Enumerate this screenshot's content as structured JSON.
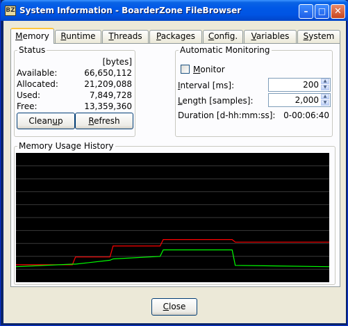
{
  "window": {
    "title": "System Information - BoarderZone FileBrowser",
    "icon_label": "BZ",
    "minimize_icon": "minimize-icon",
    "maximize_icon": "maximize-icon",
    "close_icon": "close-icon"
  },
  "tabs": [
    {
      "label": "Memory",
      "mnemonic": "M",
      "active": true
    },
    {
      "label": "Runtime",
      "mnemonic": "R",
      "active": false
    },
    {
      "label": "Threads",
      "mnemonic": "T",
      "active": false
    },
    {
      "label": "Packages",
      "mnemonic": "P",
      "active": false
    },
    {
      "label": "Config.",
      "mnemonic": "C",
      "active": false
    },
    {
      "label": "Variables",
      "mnemonic": "V",
      "active": false
    },
    {
      "label": "System",
      "mnemonic": "S",
      "active": false
    }
  ],
  "status": {
    "title": "Status",
    "units": "[bytes]",
    "rows": [
      {
        "label": "Available:",
        "value": "66,650,112"
      },
      {
        "label": "Allocated:",
        "value": "21,209,088"
      },
      {
        "label": "Used:",
        "value": "7,849,728"
      },
      {
        "label": "Free:",
        "value": "13,359,360"
      }
    ],
    "cleanup_label": "Cleanup",
    "refresh_label": "Refresh"
  },
  "monitoring": {
    "title": "Automatic Monitoring",
    "monitor_label": "Monitor",
    "monitor_checked": false,
    "interval_label": "Interval [ms]:",
    "interval_value": "200",
    "length_label": "Length [samples]:",
    "length_value": "2,000",
    "duration_label": "Duration [d-hh:mm:ss]:",
    "duration_value": "0-00:06:40"
  },
  "history": {
    "title": "Memory Usage History"
  },
  "chart_data": {
    "type": "line",
    "background": "#000000",
    "grid": true,
    "grid_color": "#3a3a3a",
    "y_gridlines": 10,
    "ylim": [
      0,
      10
    ],
    "x": [
      0,
      18,
      19,
      30,
      31,
      46,
      47,
      69,
      70,
      100
    ],
    "series": [
      {
        "color": "#ff0000",
        "values": [
          1.35,
          1.35,
          1.95,
          1.95,
          2.8,
          2.8,
          3.3,
          3.3,
          3.1,
          3.1
        ]
      },
      {
        "color": "#00ff00",
        "values": [
          1.2,
          1.4,
          1.4,
          1.7,
          1.8,
          2.0,
          2.5,
          2.5,
          1.3,
          1.2
        ]
      }
    ]
  },
  "footer": {
    "close_label": "Close"
  }
}
